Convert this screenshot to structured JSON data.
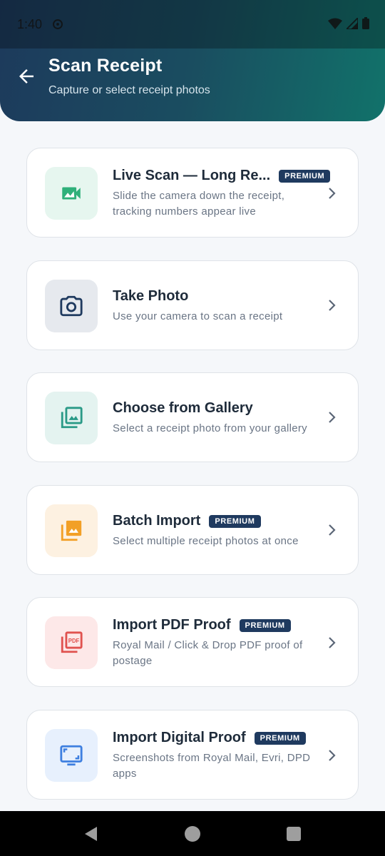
{
  "status_bar": {
    "time": "1:40"
  },
  "header": {
    "title": "Scan Receipt",
    "subtitle": "Capture or select receipt photos"
  },
  "options": [
    {
      "title": "Live Scan — Long Re...",
      "badge": "PREMIUM",
      "description": "Slide the camera down the receipt, tracking numbers appear live",
      "icon": "video-camera-icon",
      "icon_color": "#2fb07a",
      "icon_bg": "#e6f6ef"
    },
    {
      "title": "Take Photo",
      "badge": "",
      "description": "Use your camera to scan a receipt",
      "icon": "camera-icon",
      "icon_color": "#1f3a5f",
      "icon_bg": "#e6e9ee"
    },
    {
      "title": "Choose from Gallery",
      "badge": "",
      "description": "Select a receipt photo from your gallery",
      "icon": "photo-library-icon",
      "icon_color": "#2a9a87",
      "icon_bg": "#e4f3f0"
    },
    {
      "title": "Batch Import",
      "badge": "PREMIUM",
      "description": "Select multiple receipt photos at once",
      "icon": "photo-stack-icon",
      "icon_color": "#f2a026",
      "icon_bg": "#fdf1e1"
    },
    {
      "title": "Import PDF Proof",
      "badge": "PREMIUM",
      "description": "Royal Mail / Click & Drop PDF proof of postage",
      "icon": "pdf-icon",
      "icon_color": "#e0524f",
      "icon_bg": "#fde8e8"
    },
    {
      "title": "Import Digital Proof",
      "badge": "PREMIUM",
      "description": "Screenshots from Royal Mail, Evri, DPD apps",
      "icon": "screenshot-monitor-icon",
      "icon_color": "#3e7fe0",
      "icon_bg": "#e7f0fd"
    }
  ],
  "nav_bar": {
    "back": "back-triangle-icon",
    "home": "home-circle-icon",
    "recents": "recents-square-icon"
  }
}
